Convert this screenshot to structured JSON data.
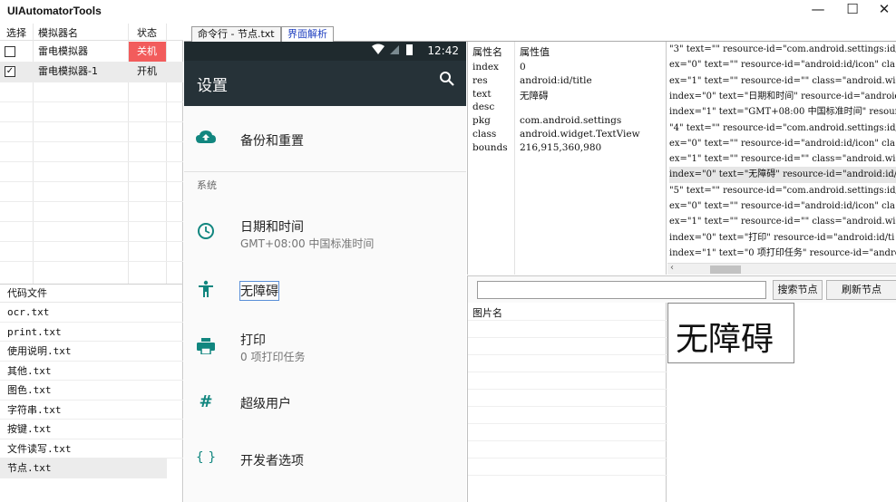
{
  "app": {
    "title": "UIAutomatorTools"
  },
  "window_controls": {
    "minimize": "—",
    "maximize": "☐",
    "close": "✕"
  },
  "emulators": {
    "headers": {
      "select": "选择",
      "name": "模拟器名",
      "status": "状态"
    },
    "rows": [
      {
        "checked": "",
        "name": "雷电模拟器",
        "status": "关机"
      },
      {
        "checked": "✓",
        "name": "雷电模拟器-1",
        "status": "开机"
      }
    ]
  },
  "files": {
    "header": "代码文件",
    "items": [
      "ocr.txt",
      "print.txt",
      "使用说明.txt",
      "其他.txt",
      "图色.txt",
      "字符串.txt",
      "按键.txt",
      "文件读写.txt",
      "节点.txt"
    ]
  },
  "tabs": [
    {
      "label": "命令行 - 节点.txt"
    },
    {
      "label": "界面解析"
    }
  ],
  "phone": {
    "time": "12:42",
    "title": "设置",
    "items": {
      "backup": "备份和重置",
      "section_system": "系统",
      "datetime": "日期和时间",
      "datetime_sub": "GMT+08:00 中国标准时间",
      "accessibility": "无障碍",
      "print": "打印",
      "print_sub": "0 项打印任务",
      "superuser": "超级用户",
      "developer": "开发者选项"
    }
  },
  "properties": {
    "headers": {
      "key": "属性名",
      "value": "属性值"
    },
    "rows": [
      {
        "k": "index",
        "v": "0"
      },
      {
        "k": "res",
        "v": "android:id/title"
      },
      {
        "k": "text",
        "v": "无障碍"
      },
      {
        "k": "desc",
        "v": ""
      },
      {
        "k": "pkg",
        "v": "com.android.settings"
      },
      {
        "k": "class",
        "v": "android.widget.TextView"
      },
      {
        "k": "bounds",
        "v": "216,915,360,980"
      }
    ]
  },
  "xml_lines": [
    "\"3\" text=\"\" resource-id=\"com.android.settings:id/",
    "ex=\"0\" text=\"\" resource-id=\"android:id/icon\" cla",
    "ex=\"1\" text=\"\" resource-id=\"\" class=\"android.wid",
    "index=\"0\" text=\"日期和时间\" resource-id=\"android",
    "index=\"1\" text=\"GMT+08:00 中国标准时间\" resource",
    "\"4\" text=\"\" resource-id=\"com.android.settings:id/",
    "ex=\"0\" text=\"\" resource-id=\"android:id/icon\" cla",
    "ex=\"1\" text=\"\" resource-id=\"\" class=\"android.wid",
    "index=\"0\" text=\"无障碍\" resource-id=\"android:id/",
    "\"5\" text=\"\" resource-id=\"com.android.settings:id/",
    "ex=\"0\" text=\"\" resource-id=\"android:id/icon\" cla",
    "ex=\"1\" text=\"\" resource-id=\"\" class=\"android.wid",
    "index=\"0\" text=\"打印\" resource-id=\"android:id/ti",
    "index=\"1\" text=\"0 项打印任务\" resource-id=\"andro"
  ],
  "search": {
    "value": "",
    "search_label": "搜索节点",
    "refresh_label": "刷新节点"
  },
  "image_list": {
    "header": "图片名"
  },
  "preview": {
    "text": "无障碍"
  }
}
